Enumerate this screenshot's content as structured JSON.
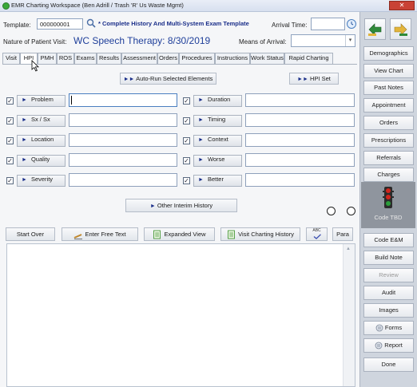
{
  "window": {
    "title": "EMR Charting Workspace (Ben Adrill / Trash 'R' Us Waste Mgmt)",
    "close_glyph": "✕"
  },
  "header": {
    "template_label": "Template:",
    "template_value": "000000001",
    "template_name": "* Complete History And Multi-System Exam Template",
    "arrival_time_label": "Arrival Time:",
    "arrival_time_value": "",
    "nature_label": "Nature of Patient Visit:",
    "nature_value": "WC Speech Therapy: 8/30/2019",
    "means_label": "Means of Arrival:",
    "means_value": ""
  },
  "tabs": [
    "Visit",
    "HPI",
    "PMH",
    "ROS",
    "Exams",
    "Results",
    "Assessment",
    "Orders",
    "Procedures",
    "Instructions",
    "Work Status",
    "Rapid Charting"
  ],
  "active_tab": "HPI",
  "hpi": {
    "auto_run_label": "Auto-Run Selected Elements",
    "hpi_set_label": "HPI Set",
    "left_elements": [
      {
        "label": "Problem",
        "checked": true,
        "value": ""
      },
      {
        "label": "Sx / Sx",
        "checked": true,
        "value": ""
      },
      {
        "label": "Location",
        "checked": true,
        "value": ""
      },
      {
        "label": "Quality",
        "checked": true,
        "value": ""
      },
      {
        "label": "Severity",
        "checked": true,
        "value": ""
      }
    ],
    "right_elements": [
      {
        "label": "Duration",
        "checked": true,
        "value": ""
      },
      {
        "label": "Timing",
        "checked": true,
        "value": ""
      },
      {
        "label": "Context",
        "checked": true,
        "value": ""
      },
      {
        "label": "Worse",
        "checked": true,
        "value": ""
      },
      {
        "label": "Better",
        "checked": true,
        "value": ""
      }
    ],
    "other_interim_label": "Other Interim History",
    "checkmark": "✓",
    "arrow": "►",
    "double_arrow": "►►"
  },
  "toolbar": {
    "start_over": "Start Over",
    "enter_free_text": "Enter Free Text",
    "expanded_view": "Expanded View",
    "visit_charting_history": "Visit Charting History",
    "spell_check": "ABC",
    "para": "Para"
  },
  "sidebar": {
    "buttons": [
      "Demographics",
      "View Chart",
      "Past Notes",
      "Appointment",
      "Orders",
      "Prescriptions",
      "Referrals",
      "Charges"
    ],
    "code_tbd": "Code TBD",
    "lower_buttons": [
      "Code E&M",
      "Build Note",
      "Review",
      "Audit",
      "Images",
      "Forms",
      "Report",
      "Done"
    ]
  },
  "colors": {
    "accent_blue": "#1b2f8a",
    "nature_text": "#1f3f9a",
    "traffic_red": "#d0241c",
    "traffic_green": "#2a9d3a"
  }
}
